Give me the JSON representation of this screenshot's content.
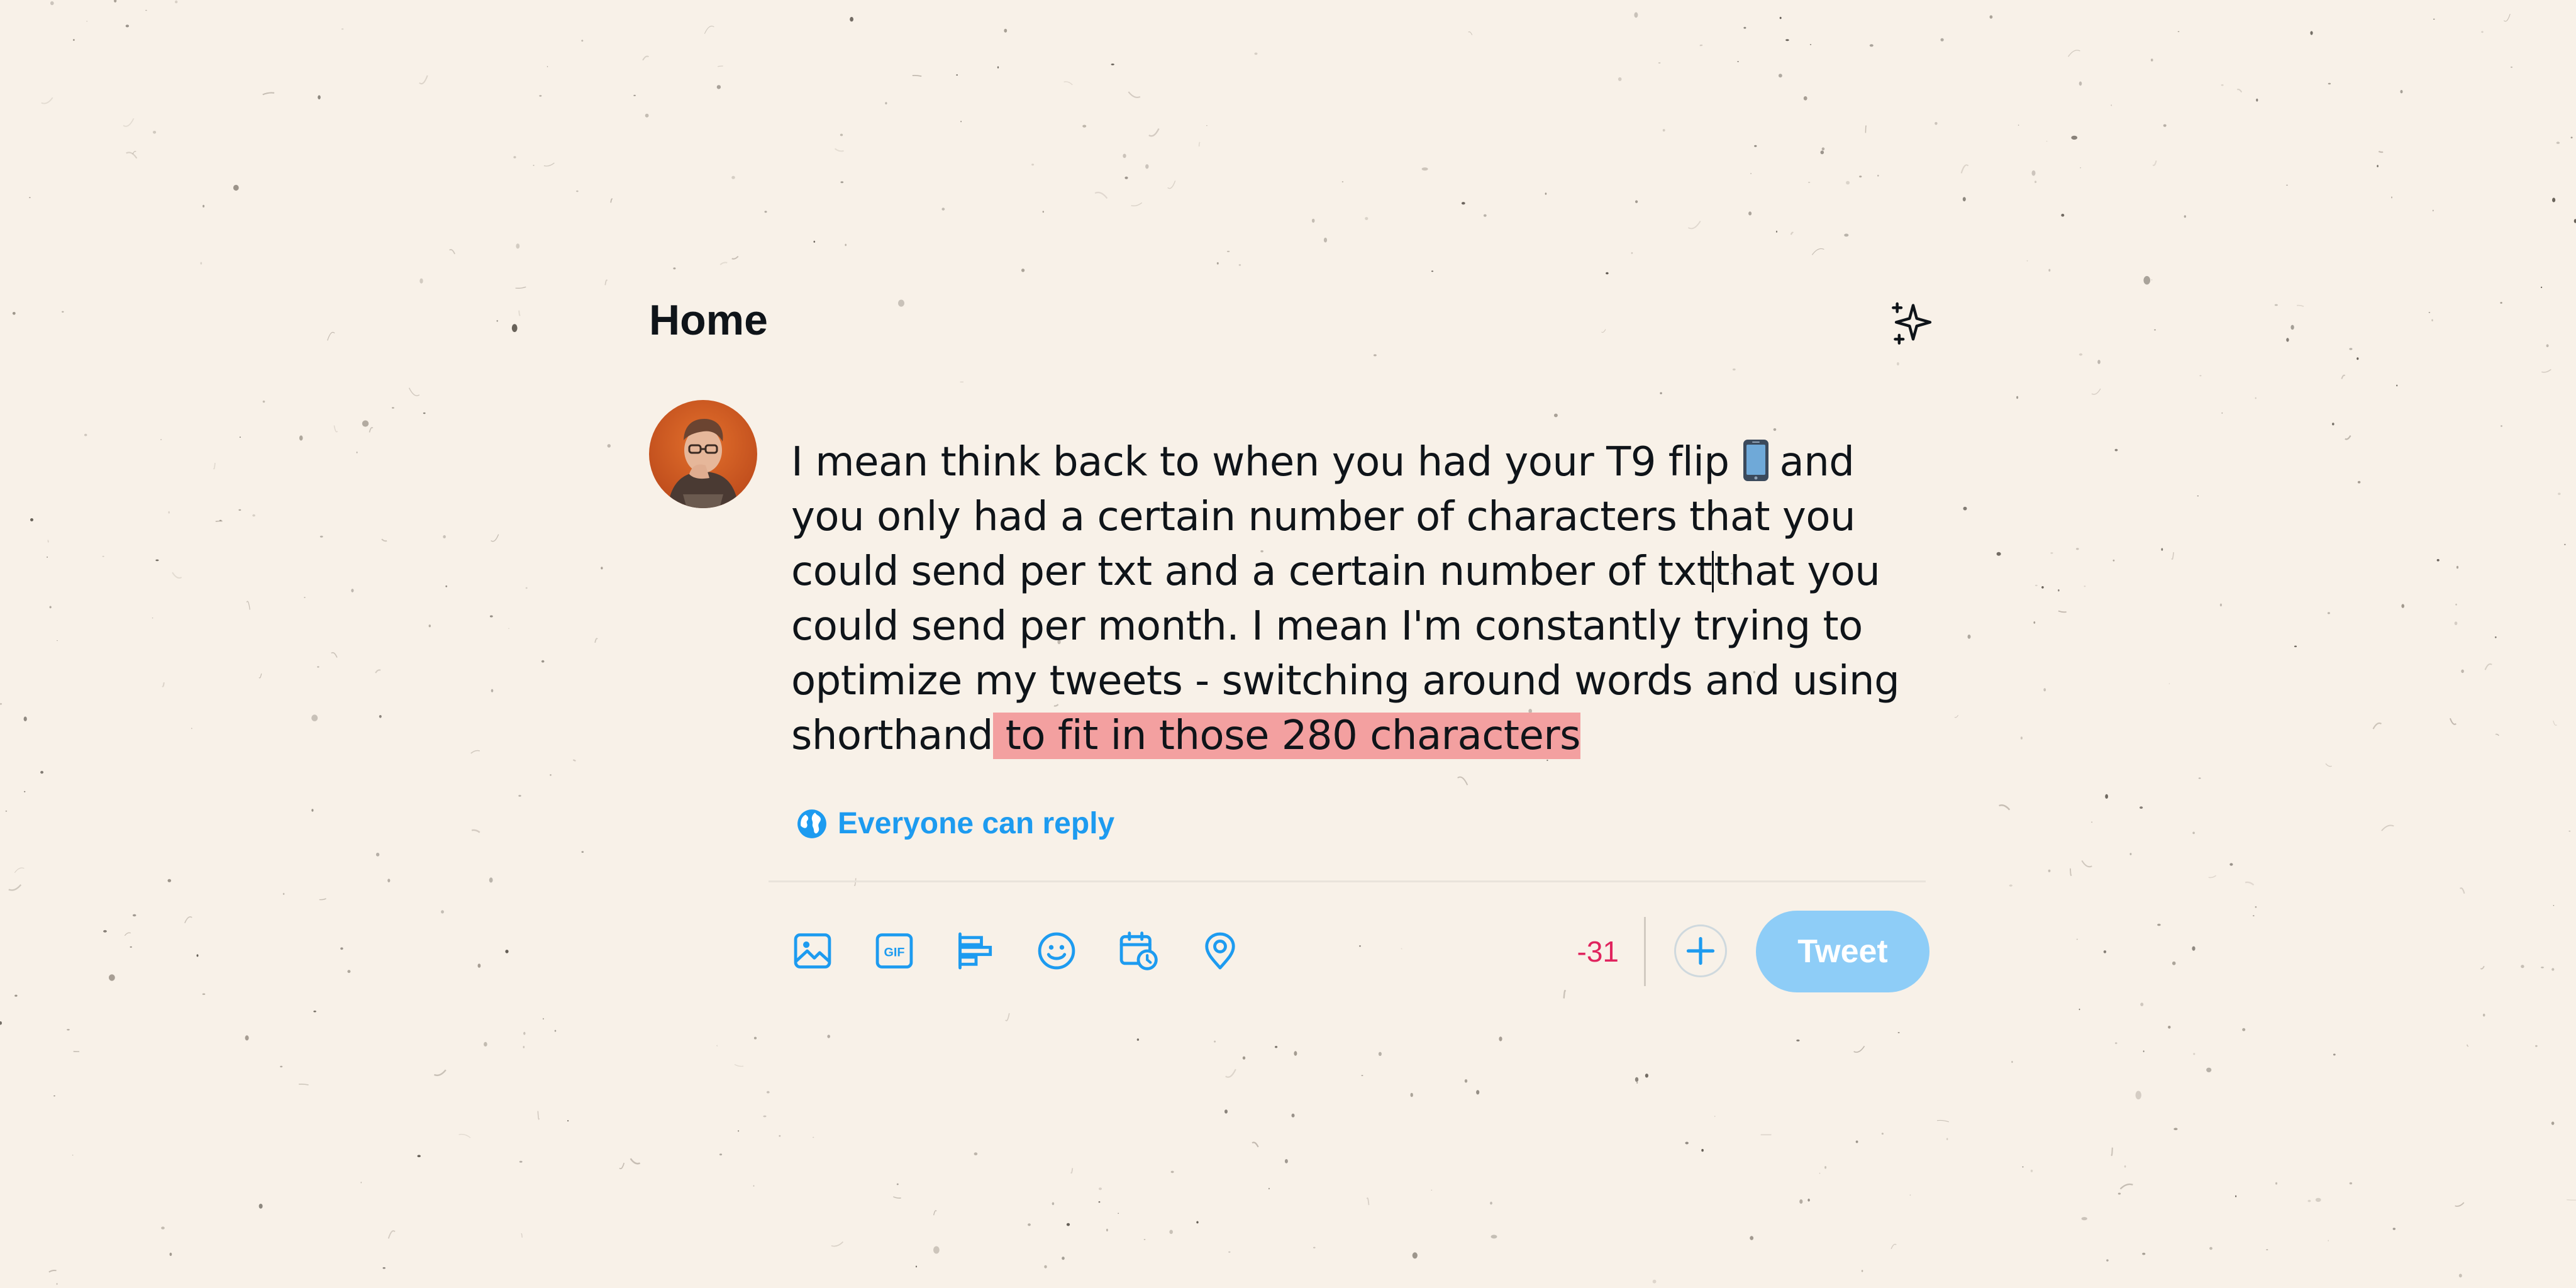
{
  "header": {
    "title": "Home",
    "top_tweets_icon": "sparkle-icon"
  },
  "composer": {
    "avatar_icon": "avatar",
    "text_lines": [
      {
        "before": "I mean think back to when you had your T9 flip",
        "after": "and"
      },
      "you only had a certain number of characters that you",
      {
        "before": "could send per txt and a certain number of txt",
        "after": "that you"
      },
      "could send per month. I mean I'm constantly trying to",
      "optimize my tweets - switching around words and using",
      {
        "before": "shorthand",
        "overflow": " to fit in those 280 characters"
      }
    ],
    "emoji_icon": "mobile-phone-emoji"
  },
  "reply_setting": {
    "icon": "globe-icon",
    "label": "Everyone can reply"
  },
  "toolbar": {
    "icons": [
      "image-icon",
      "gif-icon",
      "poll-icon",
      "emoji-icon",
      "schedule-icon",
      "location-icon"
    ],
    "gif_text": "GIF",
    "char_remaining": "-31",
    "add_icon": "plus-icon",
    "tweet_label": "Tweet"
  },
  "colors": {
    "background": "#f8f1e8",
    "accent": "#1d9bf0",
    "tweet_disabled": "#8ecdf7",
    "overflow_highlight": "#f3a0a0",
    "over_limit": "#e0245e",
    "text": "#0f1419"
  }
}
